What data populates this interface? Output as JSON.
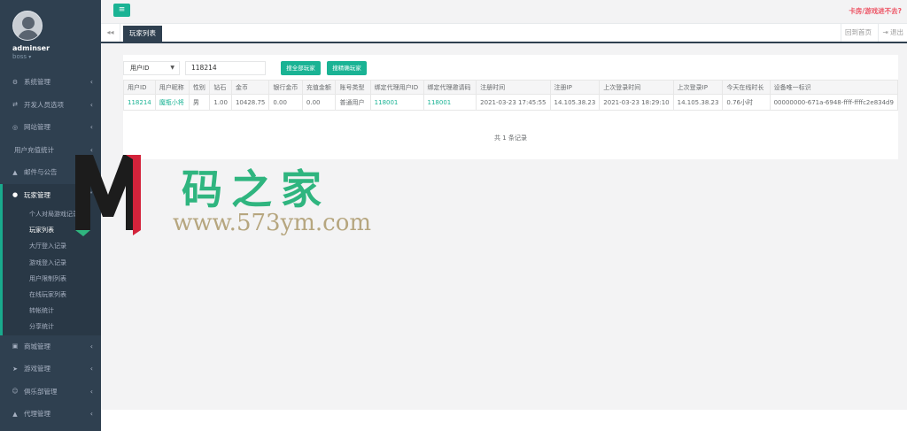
{
  "profile": {
    "name": "adminser",
    "role": "boss"
  },
  "nav": [
    {
      "label": "系统管理",
      "icon": "gears-icon",
      "glyph": "⚙"
    },
    {
      "label": "开发人员选项",
      "icon": "exchange-icon",
      "glyph": "⇄"
    },
    {
      "label": "网站管理",
      "icon": "dashboard-icon",
      "glyph": "◎"
    },
    {
      "label": "用户充值统计",
      "icon": "",
      "glyph": ""
    },
    {
      "label": "邮件与公告",
      "icon": "bell-icon",
      "glyph": "▲"
    }
  ],
  "active_group": {
    "label": "玩家管理",
    "icon": "user-icon",
    "items": [
      "个人对局游戏记录",
      "玩家列表",
      "大厅登入记录",
      "游戏登入记录",
      "用户限制列表",
      "在线玩家列表",
      "转帐统计",
      "分享统计"
    ],
    "active_item": "玩家列表"
  },
  "nav_bottom": [
    {
      "label": "商城管理",
      "icon": "cart-icon",
      "glyph": "▣"
    },
    {
      "label": "游戏管理",
      "icon": "paper-plane-icon",
      "glyph": "➤"
    },
    {
      "label": "俱乐部管理",
      "icon": "users-icon",
      "glyph": "☺"
    },
    {
      "label": "代理管理",
      "icon": "user-icon",
      "glyph": "▲"
    }
  ],
  "topbar": {
    "notice": "卡房/游戏进不去?"
  },
  "tabs": {
    "active": "玩家列表",
    "home": "回到首页",
    "logout": "退出"
  },
  "filters": {
    "field_select": "用户ID",
    "search_value": "118214",
    "btn_all": "搜全部玩家",
    "btn_precise": "搜精确玩家"
  },
  "table": {
    "headers": [
      "用户ID",
      "用户昵称",
      "性别",
      "钻石",
      "金币",
      "银行金币",
      "充值金额",
      "账号类型",
      "绑定代理用户ID",
      "绑定代理邀请码",
      "注册时间",
      "注册IP",
      "上次登录时间",
      "上次登录IP",
      "今天在线时长",
      "设备唯一标识"
    ],
    "rows": [
      [
        "118214",
        "魔瓶小将",
        "男",
        "1.00",
        "10428.75",
        "0.00",
        "0.00",
        "普通用户",
        "118001",
        "118001",
        "2021-03-23 17:45:55",
        "14.105.38.23",
        "2021-03-23 18:29:10",
        "14.105.38.23",
        "0.76小时",
        "00000000-671a-6948-ffff-ffffc2e834d9"
      ]
    ],
    "record_count": "共 1 条记录"
  },
  "watermark": {
    "cn": "码之家",
    "url": "www.573ym.com"
  }
}
